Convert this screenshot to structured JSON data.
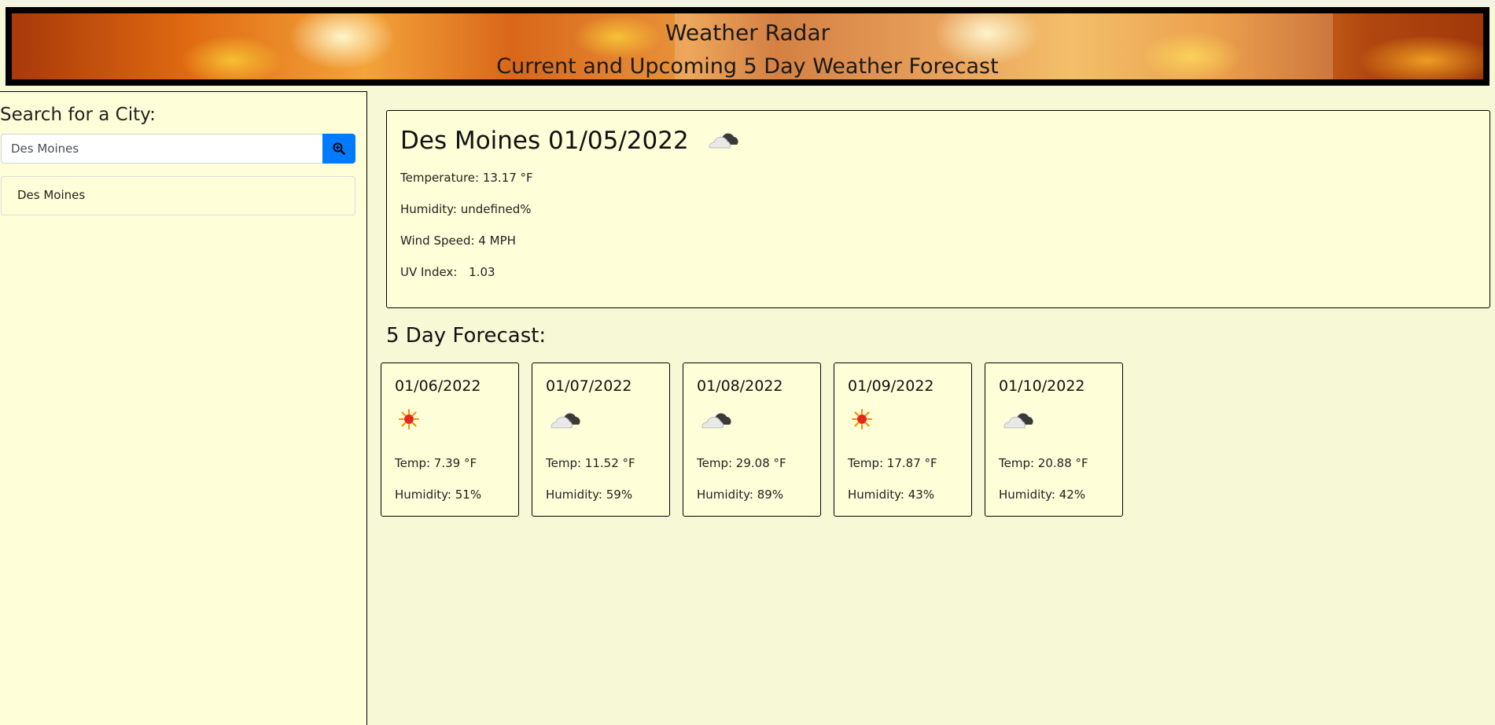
{
  "header": {
    "title": "Weather Radar",
    "subtitle": "Current and Upcoming 5 Day Weather Forecast"
  },
  "sidebar": {
    "heading": "Search for a City:",
    "search_value": "Des Moines",
    "search_button_icon": "search-icon",
    "history": [
      "Des Moines"
    ]
  },
  "current": {
    "title": "Des Moines 01/05/2022",
    "icon": "cloud-icon",
    "temperature": "Temperature: 13.17 °F",
    "humidity": "Humidity: undefined%",
    "wind": "Wind Speed: 4 MPH",
    "uv_label": "UV Index:",
    "uv_value": "1.03"
  },
  "forecast": {
    "heading": "5 Day Forecast:",
    "days": [
      {
        "date": "01/06/2022",
        "icon": "sun-icon",
        "temp": "Temp: 7.39 °F",
        "humidity": "Humidity: 51%"
      },
      {
        "date": "01/07/2022",
        "icon": "cloud-icon",
        "temp": "Temp: 11.52 °F",
        "humidity": "Humidity: 59%"
      },
      {
        "date": "01/08/2022",
        "icon": "cloud-icon",
        "temp": "Temp: 29.08 °F",
        "humidity": "Humidity: 89%"
      },
      {
        "date": "01/09/2022",
        "icon": "sun-icon",
        "temp": "Temp: 17.87 °F",
        "humidity": "Humidity: 43%"
      },
      {
        "date": "01/10/2022",
        "icon": "cloud-icon",
        "temp": "Temp: 20.88 °F",
        "humidity": "Humidity: 42%"
      }
    ]
  },
  "colors": {
    "page_background": "#f7f8d6",
    "panel_background": "#fefed8",
    "search_button": "#007bff"
  }
}
